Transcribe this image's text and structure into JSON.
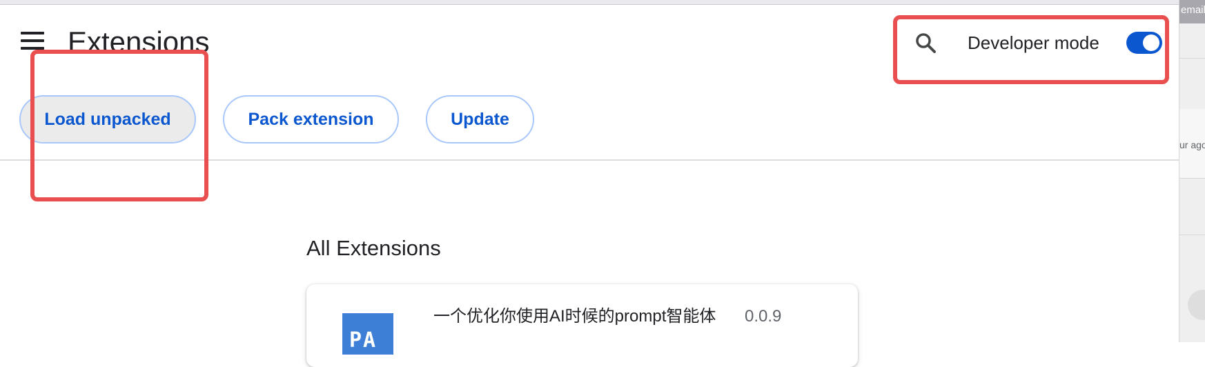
{
  "header": {
    "title": "Extensions",
    "developer_mode_label": "Developer mode",
    "developer_mode_on": true
  },
  "toolbar": {
    "load_unpacked": "Load unpacked",
    "pack_extension": "Pack extension",
    "update": "Update"
  },
  "main": {
    "section_title": "All Extensions",
    "extensions": [
      {
        "name": "一个优化你使用AI时候的prompt智能体",
        "version": "0.0.9",
        "icon_text": "PA"
      }
    ]
  },
  "side_window": {
    "top_text": "email",
    "mid_text": "ur ago"
  },
  "colors": {
    "accent": "#0b57d0",
    "pill_border": "#a8c7fa",
    "annotation": "#ea4f4f"
  }
}
